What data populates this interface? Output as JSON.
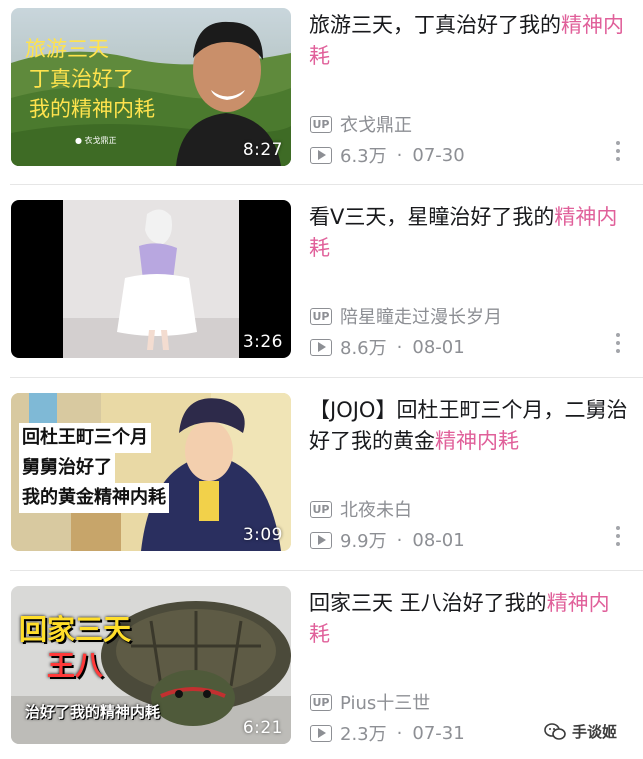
{
  "videos": [
    {
      "title_plain": "旅游三天，丁真治好了我的",
      "title_hl": "精神内耗",
      "uploader": "衣戈鼎正",
      "views": "6.3万",
      "date": "07-30",
      "duration": "8:27",
      "thumb_lines": [
        "旅游三天",
        "丁真治好了",
        "我的精神内耗"
      ],
      "thumb_caption": "● 衣戈鼎正"
    },
    {
      "title_plain": "看V三天，星瞳治好了我的",
      "title_hl": "精神内耗",
      "uploader": "陪星瞳走过漫长岁月",
      "views": "8.6万",
      "date": "08-01",
      "duration": "3:26"
    },
    {
      "title_plain": "【JOJO】回杜王町三个月，二舅治好了我的黄金",
      "title_hl": "精神内耗",
      "uploader": "北夜未白",
      "views": "9.9万",
      "date": "08-01",
      "duration": "3:09",
      "thumb_lines": [
        "回杜王町三个月",
        "舅舅治好了",
        "我的黄金精神内耗"
      ]
    },
    {
      "title_plain": "回家三天 王八治好了我的",
      "title_hl": "精神内耗",
      "uploader": "Pius十三世",
      "views": "2.3万",
      "date": "07-31",
      "duration": "6:21",
      "thumb_lines": [
        "回家三天",
        "王八",
        "治好了我的精神内耗"
      ]
    }
  ],
  "up_label": "UP",
  "separator": "·",
  "watermark": "手谈姬",
  "colors": {
    "highlight": "#e0609a",
    "meta": "#8d8f94",
    "title": "#18191c"
  },
  "icons": {
    "up": "up-badge-icon",
    "play": "play-count-icon",
    "more": "more-vertical-icon",
    "wechat": "wechat-icon"
  }
}
